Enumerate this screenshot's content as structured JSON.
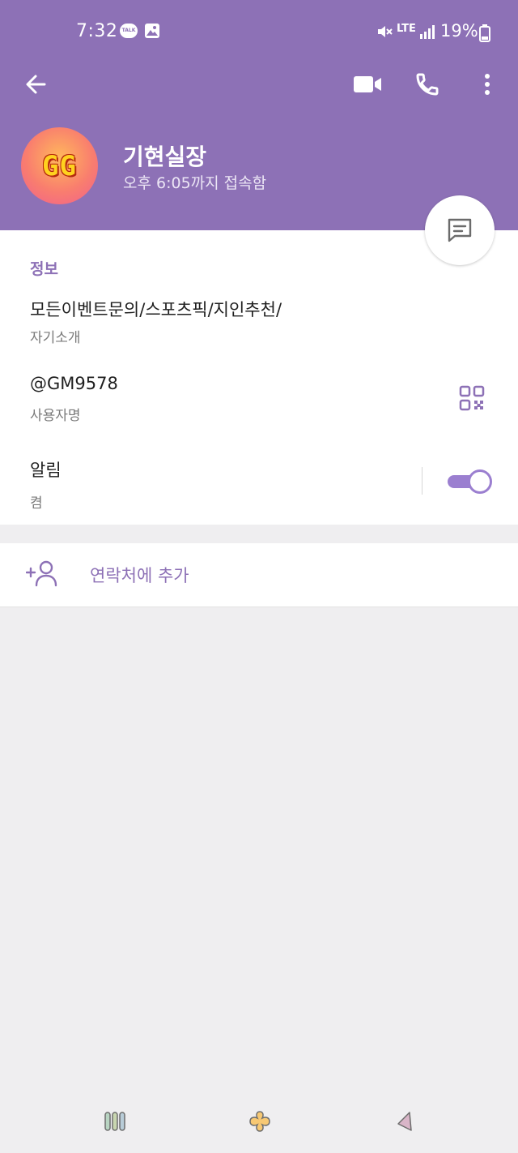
{
  "status_bar": {
    "time": "7:32",
    "talk_badge": "TALK",
    "network": "LTE",
    "battery": "19%"
  },
  "toolbar": {
    "icons": [
      "back-arrow-icon",
      "video-camera-icon",
      "phone-icon",
      "more-vertical-icon"
    ]
  },
  "profile": {
    "avatar_text": "GG",
    "name": "기현실장",
    "last_seen": "오후 6:05까지 접속함"
  },
  "info": {
    "section_title": "정보",
    "bio_value": "모든이벤트문의/스포츠픽/지인추천/",
    "bio_label": "자기소개",
    "username_value": "@GM9578",
    "username_label": "사용자명",
    "notifications_value": "알림",
    "notifications_state": "켬",
    "notifications_on": true
  },
  "actions": {
    "add_contact": "연락처에 추가"
  },
  "colors": {
    "header": "#8d71b6",
    "accent": "#9b7fd0",
    "background": "#efeef0"
  }
}
